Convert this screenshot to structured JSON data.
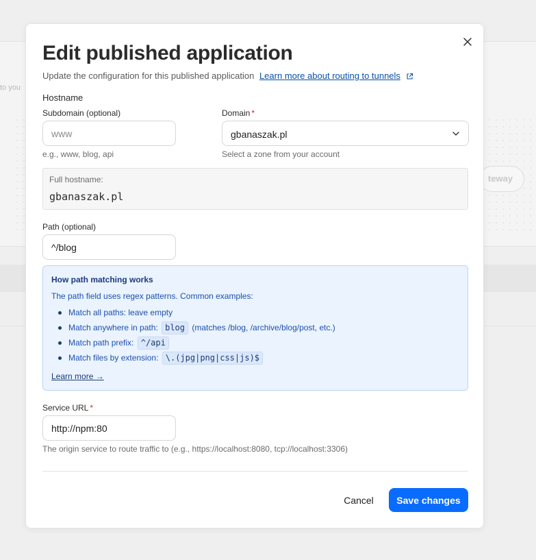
{
  "background": {
    "edge_text": "to you",
    "pill_label": "teway"
  },
  "modal": {
    "title": "Edit published application",
    "subtitle": "Update the configuration for this published application",
    "routing_link": "Learn more about routing to tunnels",
    "close_icon": "close-icon"
  },
  "hostname": {
    "section_label": "Hostname",
    "subdomain": {
      "label": "Subdomain (optional)",
      "placeholder": "www",
      "value": "",
      "hint": "e.g., www, blog, api"
    },
    "domain": {
      "label": "Domain",
      "required_mark": "*",
      "selected": "gbanaszak.pl",
      "hint": "Select a zone from your account"
    },
    "full_hostname": {
      "label": "Full hostname:",
      "value": "gbanaszak.pl"
    }
  },
  "path": {
    "label": "Path (optional)",
    "placeholder": "",
    "value": "^/blog"
  },
  "path_help": {
    "title": "How path matching works",
    "description": "The path field uses regex patterns. Common examples:",
    "items": [
      {
        "label": "Match all paths:",
        "text": "leave empty",
        "code": ""
      },
      {
        "label": "Match anywhere in path:",
        "code": "blog",
        "text": "(matches /blog, /archive/blog/post, etc.)"
      },
      {
        "label": "Match path prefix:",
        "code": "^/api",
        "text": ""
      },
      {
        "label": "Match files by extension:",
        "code": "\\.(jpg|png|css|js)$",
        "text": ""
      }
    ],
    "learn_more": "Learn more →"
  },
  "service": {
    "label": "Service URL",
    "required_mark": "*",
    "value": "http://npm:80",
    "hint": "The origin service to route traffic to (e.g., https://localhost:8080, tcp://localhost:3306)"
  },
  "footer": {
    "cancel_label": "Cancel",
    "save_label": "Save changes"
  },
  "colors": {
    "accent": "#0a6cff",
    "link": "#0a4fa8",
    "info_bg": "#eaf3fe",
    "required": "#d12b2b"
  }
}
